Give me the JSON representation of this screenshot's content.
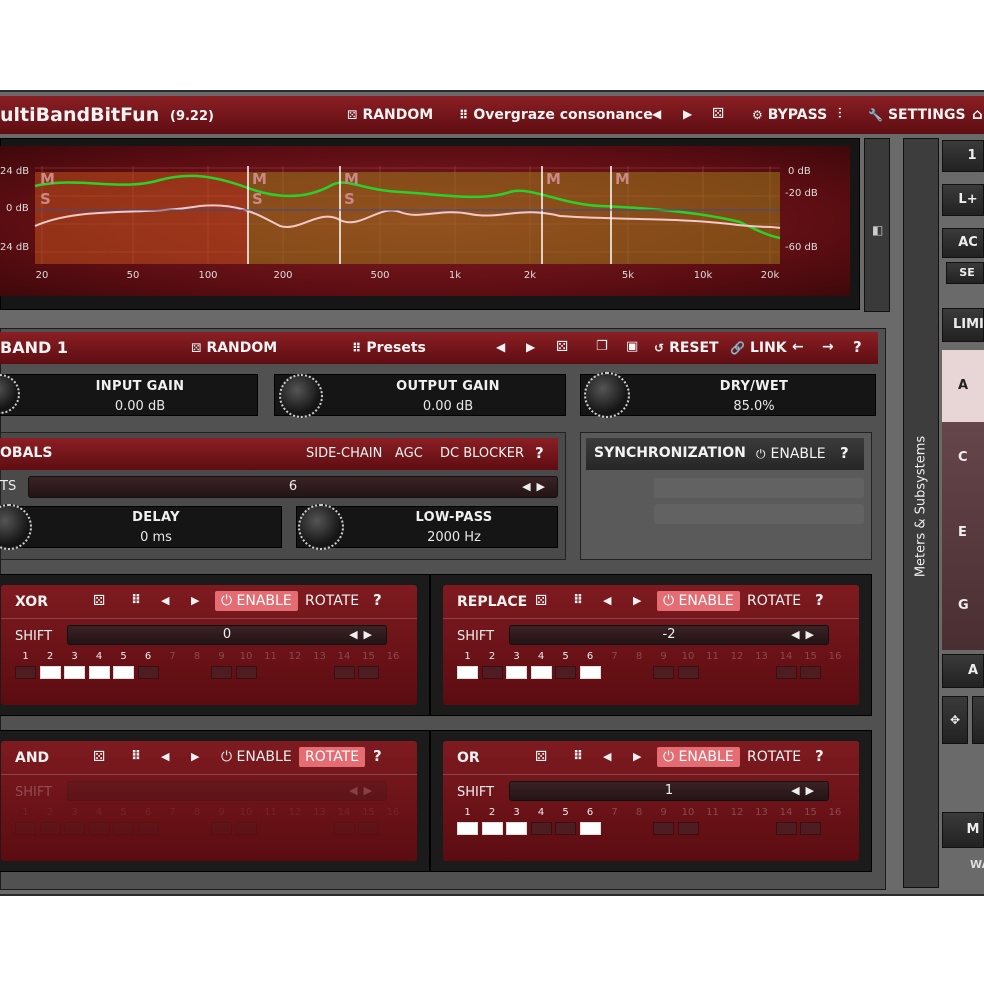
{
  "app": {
    "title": "ultiBandBitFun",
    "version": "(9.22)"
  },
  "topbar": {
    "random": "RANDOM",
    "preset": "Overgraze consonance",
    "bypass": "BYPASS",
    "settings": "SETTINGS"
  },
  "spectrum": {
    "left_scale": [
      "24 dB",
      "0 dB",
      "24 dB"
    ],
    "right_scale": [
      "0 dB",
      "-20 dB",
      "-60 dB"
    ],
    "freq_ticks": [
      "20",
      "50",
      "100",
      "200",
      "500",
      "1k",
      "2k",
      "5k",
      "10k",
      "20k"
    ],
    "band_labels": [
      "M",
      "S"
    ]
  },
  "band": {
    "title": "BAND 1",
    "random": "RANDOM",
    "presets": "Presets",
    "reset": "RESET",
    "link": "LINK",
    "help": "?"
  },
  "gains": {
    "input_label": "INPUT GAIN",
    "input_value": "0.00 dB",
    "output_label": "OUTPUT GAIN",
    "output_value": "0.00 dB",
    "drywet_label": "DRY/WET",
    "drywet_value": "85.0%"
  },
  "globals": {
    "title": "OBALS",
    "sidechain": "SIDE-CHAIN",
    "agc": "AGC",
    "dcblocker": "DC BLOCKER",
    "help": "?",
    "ts_label": "TS",
    "ts_value": "6",
    "delay_label": "DELAY",
    "delay_value": "0 ms",
    "lowpass_label": "LOW-PASS",
    "lowpass_value": "2000 Hz"
  },
  "sync": {
    "title": "SYNCHRONIZATION",
    "enable": "ENABLE",
    "help": "?"
  },
  "ops": [
    {
      "title": "XOR",
      "enable": "ENABLE",
      "rotate": "ROTATE",
      "help": "?",
      "shift_label": "SHIFT",
      "shift_value": "0",
      "enabled": true,
      "rotate_active": false,
      "bits_on": [
        2,
        3,
        4,
        5
      ]
    },
    {
      "title": "REPLACE",
      "enable": "ENABLE",
      "rotate": "ROTATE",
      "help": "?",
      "shift_label": "SHIFT",
      "shift_value": "-2",
      "enabled": true,
      "rotate_active": false,
      "bits_on": [
        1,
        3,
        4,
        6
      ]
    },
    {
      "title": "AND",
      "enable": "ENABLE",
      "rotate": "ROTATE",
      "help": "?",
      "shift_label": "SHIFT",
      "shift_value": "",
      "enabled": false,
      "rotate_active": true,
      "bits_on": []
    },
    {
      "title": "OR",
      "enable": "ENABLE",
      "rotate": "ROTATE",
      "help": "?",
      "shift_label": "SHIFT",
      "shift_value": "1",
      "enabled": true,
      "rotate_active": false,
      "bits_on": [
        1,
        2,
        3,
        6
      ]
    }
  ],
  "bit_numbers": [
    "1",
    "2",
    "3",
    "4",
    "5",
    "6",
    "7",
    "8",
    "9",
    "10",
    "11",
    "12",
    "13",
    "14",
    "15",
    "16"
  ],
  "side": {
    "meters": "Meters & Subsystems"
  },
  "right_panel": {
    "btn1": "1",
    "btn2": "L+",
    "btn3": "AC",
    "btn4": "SE",
    "limit": "LIMI",
    "letters": [
      "A",
      "C",
      "E",
      "G"
    ],
    "btn5": "A",
    "btn6": "M",
    "wa": "WA"
  },
  "colors": {
    "accent": "#e36d73",
    "panel_red": "#7e1b20",
    "green_curve": "#2bd12b"
  }
}
